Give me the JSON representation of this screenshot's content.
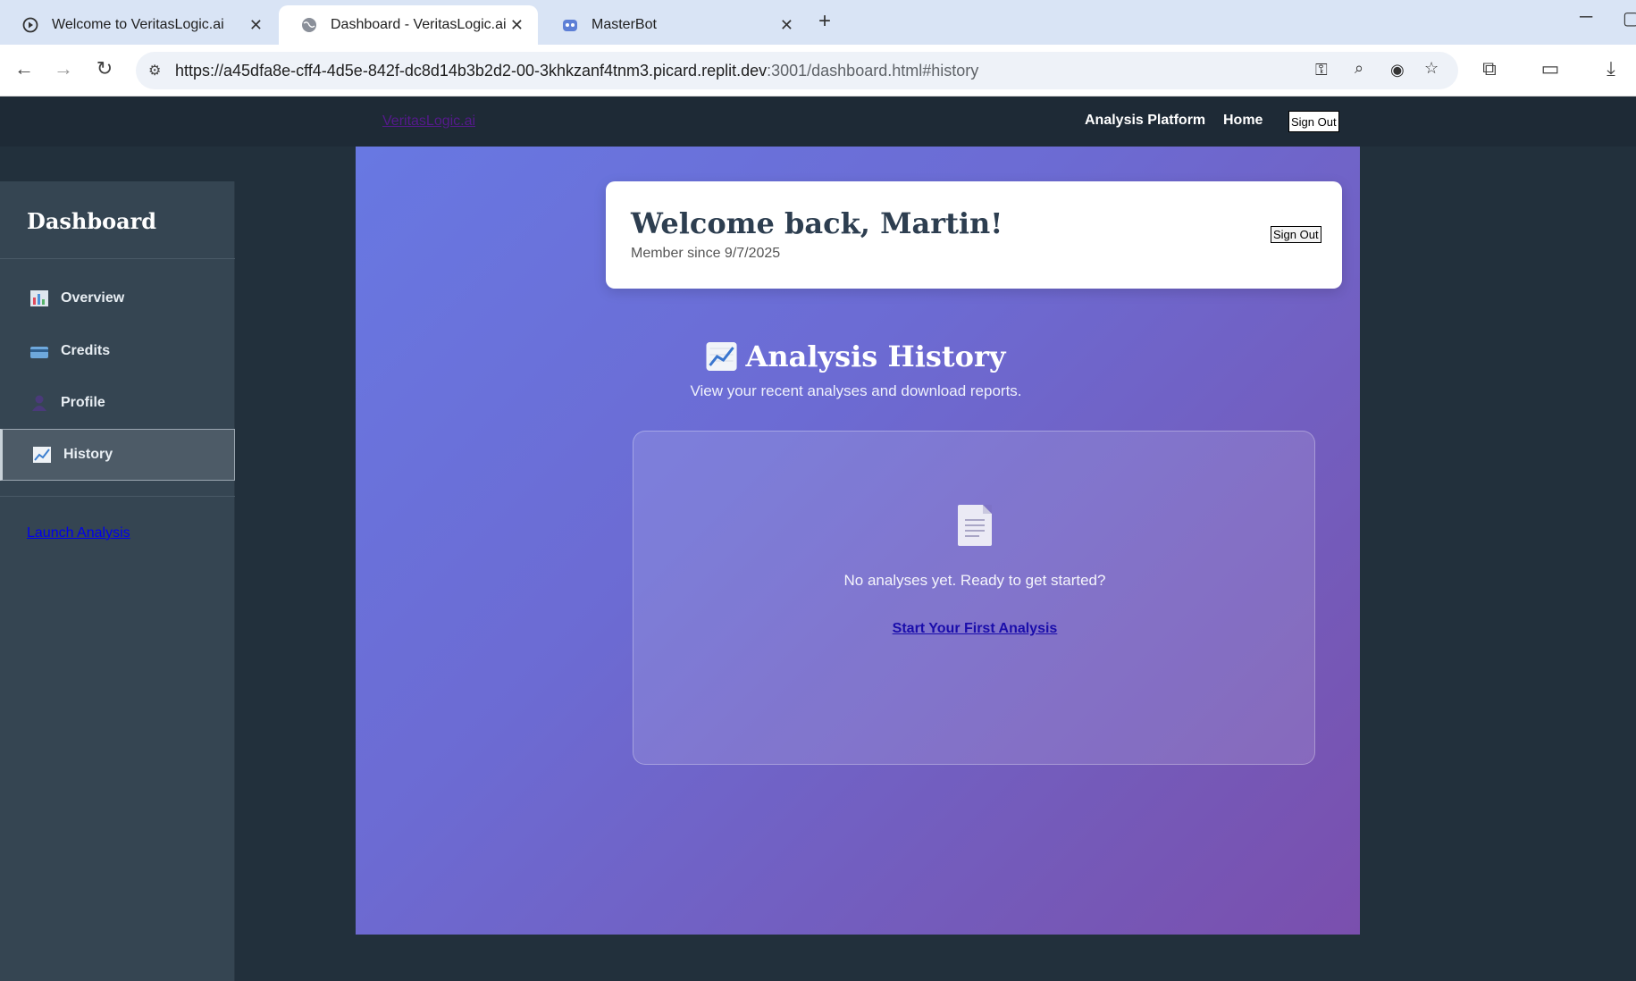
{
  "browser": {
    "tabs": [
      {
        "title": "Welcome to VeritasLogic.ai",
        "icon": "circle-play-icon",
        "active": false
      },
      {
        "title": "Dashboard - VeritasLogic.ai",
        "icon": "globe-icon",
        "active": true
      },
      {
        "title": "MasterBot",
        "icon": "robot-icon",
        "active": false
      }
    ],
    "url_main": "https://a45dfa8e-cff4-4d5e-842f-dc8d14b3b2d2-00-3khkzanf4tnm3.picard.replit.dev",
    "url_rest": ":3001/dashboard.html#history"
  },
  "site_header": {
    "brand": "VeritasLogic.ai",
    "nav": [
      "Analysis Platform",
      "Home"
    ],
    "signout": "Sign Out"
  },
  "sidebar": {
    "title": "Dashboard",
    "items": [
      {
        "label": "Overview",
        "icon": "bar-chart-icon"
      },
      {
        "label": "Credits",
        "icon": "credit-card-icon"
      },
      {
        "label": "Profile",
        "icon": "person-icon"
      },
      {
        "label": "History",
        "icon": "trend-chart-icon",
        "active": true
      }
    ],
    "launch": "Launch Analysis"
  },
  "welcome": {
    "title": "Welcome back, Martin!",
    "member_since": "Member since 9/7/2025",
    "signout": "Sign Out"
  },
  "history": {
    "title": "Analysis History",
    "subtitle": "View your recent analyses and download reports.",
    "empty_text": "No analyses yet. Ready to get started?",
    "cta": "Start Your First Analysis"
  },
  "colors": {
    "header_bg": "#1e2a36",
    "sidebar_bg": "#354552",
    "panel_gradient_start": "#6878e2",
    "panel_gradient_end": "#7a4fae"
  }
}
